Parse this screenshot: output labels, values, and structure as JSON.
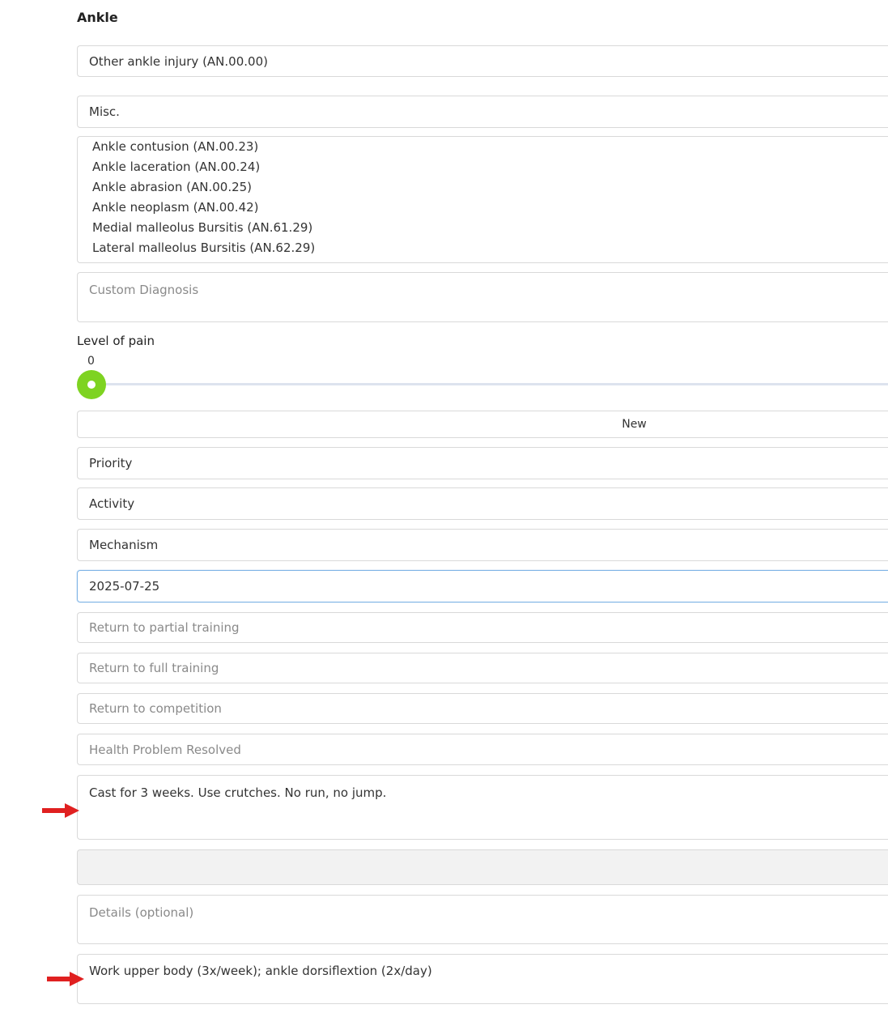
{
  "section": {
    "title": "Ankle"
  },
  "diagnosis_select": {
    "value": "Other ankle injury (AN.00.00)"
  },
  "category_select": {
    "value": "Misc."
  },
  "diagnosis_options": [
    "Ankle contusion (AN.00.23)",
    "Ankle laceration (AN.00.24)",
    "Ankle abrasion (AN.00.25)",
    "Ankle neoplasm (AN.00.42)",
    "Medial malleolus Bursitis (AN.61.29)",
    "Lateral malleolus Bursitis (AN.62.29)"
  ],
  "custom_diagnosis": {
    "placeholder": "Custom Diagnosis"
  },
  "pain": {
    "label": "Level of pain",
    "value": "0",
    "level_fraction": 0,
    "thumb_color": "#7ed321"
  },
  "status_button": {
    "label": "New"
  },
  "priority_select": {
    "value": "Priority"
  },
  "activity_select": {
    "value": "Activity"
  },
  "mechanism_select": {
    "value": "Mechanism"
  },
  "date_field": {
    "value": "2025-07-25"
  },
  "return_partial": {
    "placeholder": "Return to partial training"
  },
  "return_full": {
    "placeholder": "Return to full training"
  },
  "return_competition": {
    "placeholder": "Return to competition"
  },
  "resolved": {
    "placeholder": "Health Problem Resolved"
  },
  "treatment_notes": {
    "value": "Cast for 3 weeks. Use crutches. No run, no jump."
  },
  "details": {
    "placeholder": "Details (optional)"
  },
  "rehab_notes": {
    "value": "Work upper body (3x/week); ankle dorsiflextion (2x/day)"
  },
  "colors": {
    "arrow": "#e02020",
    "focus_border": "#7fb4e6",
    "accent": "#7ed321"
  }
}
